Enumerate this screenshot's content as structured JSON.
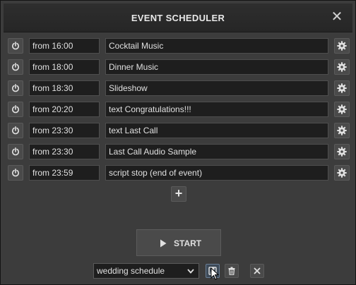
{
  "window": {
    "title": "EVENT SCHEDULER",
    "close_icon": "close-icon"
  },
  "events": [
    {
      "time": "from 16:00",
      "action": "Cocktail Music"
    },
    {
      "time": "from 18:00",
      "action": "Dinner Music"
    },
    {
      "time": "from 18:30",
      "action": "Slideshow"
    },
    {
      "time": "from 20:20",
      "action": "text Congratulations!!!"
    },
    {
      "time": "from 23:30",
      "action": "text Last Call"
    },
    {
      "time": "from 23:30",
      "action": "Last Call Audio Sample"
    },
    {
      "time": "from 23:59",
      "action": "script stop (end of event)"
    }
  ],
  "row_icons": {
    "left": "power-icon",
    "right": "gear-icon"
  },
  "add_button": {
    "label": "+"
  },
  "start_button": {
    "label": "START",
    "icon": "play-icon"
  },
  "schedule_select": {
    "value": "wedding schedule"
  },
  "bottom_icons": [
    "save-icon",
    "trash-icon",
    "close-icon"
  ],
  "colors": {
    "window_bg": "#3c3c3c",
    "titlebar_bg": "#262626",
    "field_bg": "#1e1e1e",
    "button_bg": "#4a4a4a",
    "text": "#e0e0e0"
  }
}
